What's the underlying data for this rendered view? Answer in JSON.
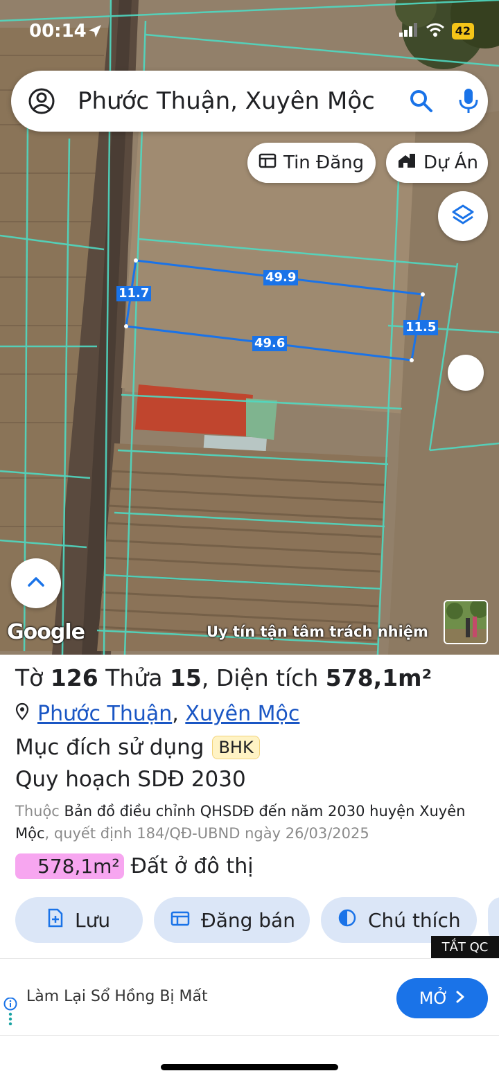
{
  "status_bar": {
    "time": "00:14",
    "battery": "42"
  },
  "search": {
    "text": "Phước Thuận, Xuyên Mộc"
  },
  "chips": {
    "listings": "Tin Đăng",
    "projects": "Dự Án"
  },
  "map": {
    "dims": {
      "top": "49.9",
      "left": "11.7",
      "right": "11.5",
      "bottom": "49.6"
    },
    "google_label": "Google",
    "watermark": "Uy tín tận tâm trách nhiệm"
  },
  "parcel": {
    "title_prefix": "Tờ ",
    "sheet_no": "126",
    "mid1": " Thửa ",
    "plot_no": "15",
    "mid2": ", Diện tích ",
    "area": "578,1m²",
    "commune": "Phước Thuận",
    "district": "Xuyên Mộc",
    "purpose_label": "Mục đích sử dụng",
    "purpose_code": "BHK",
    "plan_label": "Quy hoạch SDĐ 2030",
    "desc_prefix": "Thuộc",
    "desc_main": "Bản đồ điều chỉnh QHSDĐ đến năm 2030 huyện Xuyên Mộc",
    "desc_suffix": ", quyết định 184/QĐ-UBND ngày 26/03/2025",
    "zone_area": "578,1m²",
    "zone_type": "Đất ở đô thị"
  },
  "actions": {
    "save": "Lưu",
    "post": "Đăng bán",
    "legend": "Chú thích"
  },
  "ad": {
    "close_label": "TẮT QC",
    "text": "Làm Lại Sổ Hồng Bị Mất",
    "open": "MỞ"
  },
  "colors": {
    "accent": "#1a73e8",
    "zone_pink": "#f7a6f0",
    "badge_yellow": "#fff3c4"
  }
}
